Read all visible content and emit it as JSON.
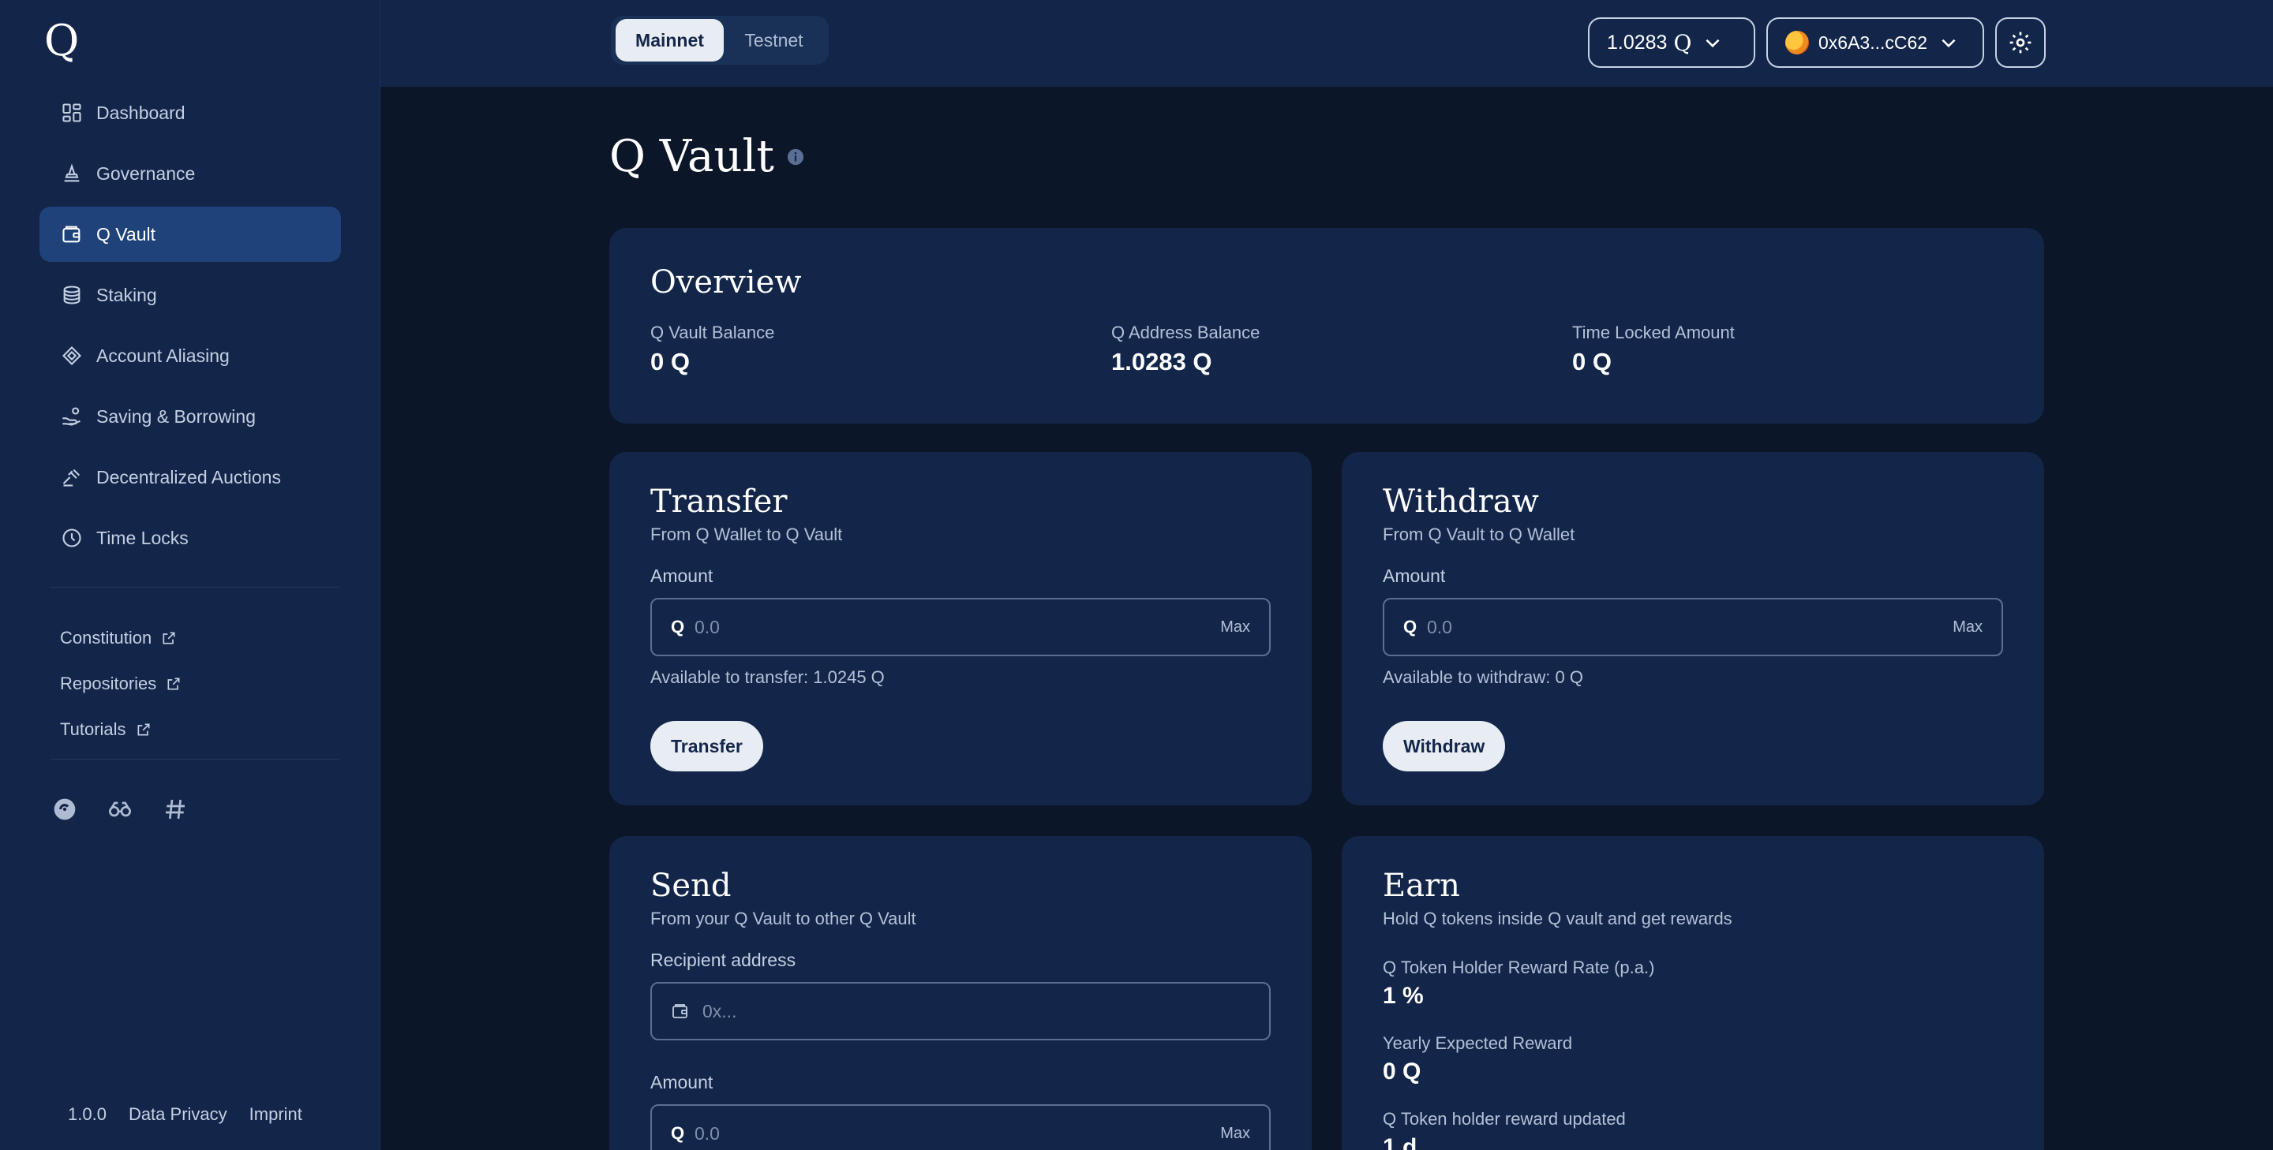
{
  "app": {
    "logo": "Q"
  },
  "sidebar": {
    "items": [
      {
        "label": "Dashboard",
        "icon": "dashboard-icon"
      },
      {
        "label": "Governance",
        "icon": "governance-icon"
      },
      {
        "label": "Q Vault",
        "icon": "wallet-icon",
        "active": true
      },
      {
        "label": "Staking",
        "icon": "coins-icon"
      },
      {
        "label": "Account Aliasing",
        "icon": "aliasing-icon"
      },
      {
        "label": "Saving & Borrowing",
        "icon": "saving-icon"
      },
      {
        "label": "Decentralized Auctions",
        "icon": "gavel-icon"
      },
      {
        "label": "Time Locks",
        "icon": "clock-icon"
      }
    ],
    "external_links": [
      {
        "label": "Constitution"
      },
      {
        "label": "Repositories"
      },
      {
        "label": "Tutorials"
      }
    ],
    "socials": [
      "explorer-icon",
      "binoculars-icon",
      "hashtag-icon"
    ],
    "footer": {
      "version": "1.0.0",
      "privacy": "Data Privacy",
      "imprint": "Imprint"
    }
  },
  "header": {
    "networks": {
      "active": "Mainnet",
      "other": "Testnet"
    },
    "balance": "1.0283",
    "address": "0x6A3...cC62"
  },
  "main": {
    "title": "Q Vault",
    "overview": {
      "title": "Overview",
      "stats": [
        {
          "label": "Q Vault Balance",
          "value": "0 Q"
        },
        {
          "label": "Q Address Balance",
          "value": "1.0283 Q"
        },
        {
          "label": "Time Locked Amount",
          "value": "0 Q"
        }
      ]
    },
    "transfer": {
      "title": "Transfer",
      "subtitle": "From Q Wallet to Q Vault",
      "amount_label": "Amount",
      "prefix": "Q",
      "placeholder": "0.0",
      "max": "Max",
      "available": "Available to transfer: 1.0245 Q",
      "button": "Transfer"
    },
    "withdraw": {
      "title": "Withdraw",
      "subtitle": "From Q Vault to Q Wallet",
      "amount_label": "Amount",
      "prefix": "Q",
      "placeholder": "0.0",
      "max": "Max",
      "available": "Available to withdraw: 0 Q",
      "button": "Withdraw"
    },
    "send": {
      "title": "Send",
      "subtitle": "From your Q Vault to other Q Vault",
      "recipient_label": "Recipient address",
      "recipient_placeholder": "0x...",
      "amount_label": "Amount",
      "prefix": "Q",
      "placeholder": "0.0",
      "max": "Max"
    },
    "earn": {
      "title": "Earn",
      "subtitle": "Hold Q tokens inside Q vault and get rewards",
      "stats": [
        {
          "label": "Q Token Holder Reward Rate (p.a.)",
          "value": "1 %"
        },
        {
          "label": "Yearly Expected Reward",
          "value": "0 Q"
        },
        {
          "label": "Q Token holder reward updated",
          "value": "1 d"
        }
      ]
    }
  }
}
